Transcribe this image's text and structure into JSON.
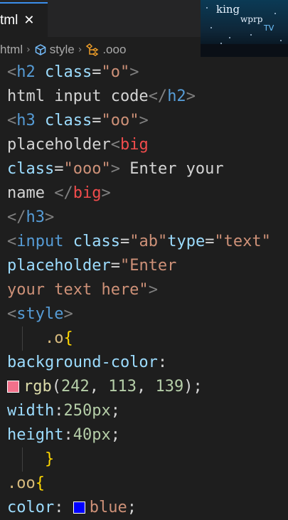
{
  "tab": {
    "label": "tml",
    "close_glyph": "✕"
  },
  "watermark": {
    "line1": "king",
    "line2": "wprp",
    "line3": "TV"
  },
  "breadcrumb": {
    "items": [
      "html",
      "style",
      ".ooo"
    ],
    "icons": [
      "cube-icon",
      "symbol-class-icon"
    ]
  },
  "colors": {
    "swatch_1": "rgb(242, 113, 139)",
    "swatch_2": "blue"
  },
  "code": {
    "l1": {
      "open": "<",
      "tag": "h2",
      "attr": " class",
      "eq": "=",
      "str": "\"o\"",
      "close": ">"
    },
    "l2": {
      "text": "html input code",
      "open": "</",
      "tag": "h2",
      "close": ">"
    },
    "l3": {
      "open": "<",
      "tag": "h3",
      "attr": " class",
      "eq": "=",
      "str": "\"oo\"",
      "close": ">"
    },
    "l4": {
      "text": "placeholder",
      "open": "<",
      "tag": "big"
    },
    "l5": {
      "attr": "class",
      "eq": "=",
      "str": "\"ooo\"",
      "close": ">",
      "text": " Enter your"
    },
    "l6": {
      "text": "name ",
      "open": "</",
      "tag": "big",
      "close": ">"
    },
    "l7": {
      "open": "</",
      "tag": "h3",
      "close": ">"
    },
    "l8": {
      "open": "<",
      "tag": "input",
      "attr1": " class",
      "eq1": "=",
      "str1": "\"ab\"",
      "attr2": "type",
      "eq2": "=",
      "str2": "\"text\""
    },
    "l9": {
      "attr": "placeholder",
      "eq": "=",
      "str": "\"Enter"
    },
    "l10": {
      "str": "your text here\"",
      "close": ">"
    },
    "l11": {
      "open": "<",
      "tag": "style",
      "close": ">"
    },
    "l12": {
      "indent": "    ",
      "sel": ".o",
      "brace": "{"
    },
    "l13": {
      "prop": "background-color",
      "colon": ":"
    },
    "l14": {
      "fn": "rgb",
      "paren_open": "(",
      "n1": "242",
      "c1": ", ",
      "n2": "113",
      "c2": ", ",
      "n3": "139",
      "paren_close": ")",
      "semi": ";"
    },
    "l15": {
      "prop": "width",
      "colon": ":",
      "num": "250px",
      "semi": ";"
    },
    "l16": {
      "prop": "height",
      "colon": ":",
      "num": "40px",
      "semi": ";"
    },
    "l17": {
      "indent": "    ",
      "brace": "}"
    },
    "l18": {
      "sel": ".oo",
      "brace": "{"
    },
    "l19": {
      "prop": "color",
      "colon": ": ",
      "val": "blue",
      "semi": ";"
    }
  }
}
